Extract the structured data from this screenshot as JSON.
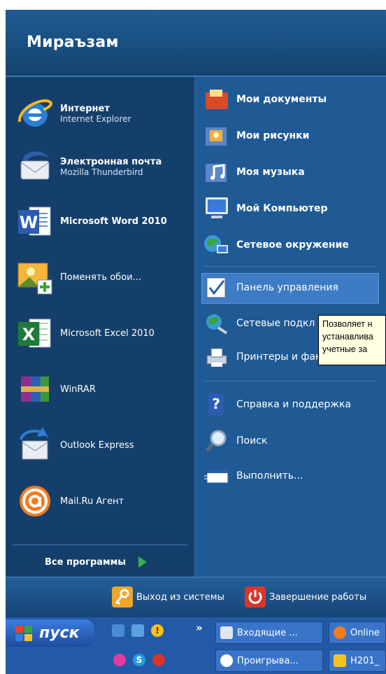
{
  "start_menu": {
    "user_name": "Мираъзам",
    "pinned": [
      {
        "title": "Интернет",
        "subtitle": "Internet Explorer",
        "icon": "internet-explorer-icon"
      },
      {
        "title": "Электронная почта",
        "subtitle": "Mozilla Thunderbird",
        "icon": "thunderbird-icon"
      }
    ],
    "recent": [
      {
        "label": "Microsoft Word 2010",
        "icon": "word-icon"
      },
      {
        "label": "Поменять обои...",
        "icon": "wallpaper-icon"
      },
      {
        "label": "Microsoft Excel 2010",
        "icon": "excel-icon"
      },
      {
        "label": "WinRAR",
        "icon": "winrar-icon"
      },
      {
        "label": "Outlook Express",
        "icon": "outlook-express-icon"
      },
      {
        "label": "Mail.Ru Агент",
        "icon": "mailru-agent-icon"
      }
    ],
    "all_programs": "Все программы",
    "places": [
      {
        "label": "Мои документы",
        "icon": "my-documents-icon"
      },
      {
        "label": "Мои рисунки",
        "icon": "my-pictures-icon"
      },
      {
        "label": "Моя музыка",
        "icon": "my-music-icon"
      },
      {
        "label": "Мой Компьютер",
        "icon": "my-computer-icon"
      },
      {
        "label": "Сетевое окружение",
        "icon": "network-places-icon"
      }
    ],
    "settings": [
      {
        "label": "Панель управления",
        "icon": "control-panel-icon"
      },
      {
        "label": "Сетевые подкл",
        "icon": "network-connections-icon"
      },
      {
        "label": "Принтеры и фак",
        "icon": "printers-icon"
      }
    ],
    "help": [
      {
        "label": "Справка и поддержка",
        "icon": "help-icon"
      },
      {
        "label": "Поиск",
        "icon": "search-icon"
      },
      {
        "label": "Выполнить...",
        "icon": "run-icon"
      }
    ],
    "tooltip_lines": [
      "Позволяет н",
      "устанавлива",
      "учетные за"
    ],
    "logoff": "Выход из системы",
    "shutdown": "Завершение работы"
  },
  "taskbar": {
    "start_label": "пуск",
    "buttons": [
      {
        "label": "Входящие ..."
      },
      {
        "label": "Online"
      },
      {
        "label": "Проигрыва..."
      },
      {
        "label": "H201_"
      }
    ]
  },
  "colors": {
    "accent": "#1c4f82",
    "taskbar": "#235aa7",
    "start_button": "#3b7de0"
  }
}
